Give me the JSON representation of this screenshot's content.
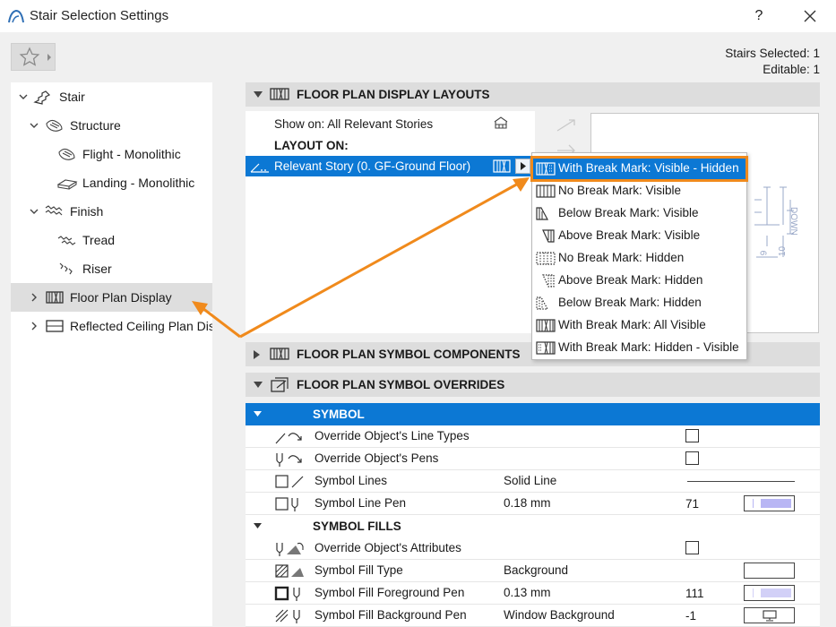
{
  "window": {
    "title": "Stair Selection Settings",
    "help_label": "?",
    "stairs_selected": "Stairs Selected: 1",
    "editable": "Editable: 1"
  },
  "tree": {
    "items": [
      {
        "label": "Stair"
      },
      {
        "label": "Structure"
      },
      {
        "label": "Flight - Monolithic"
      },
      {
        "label": "Landing - Monolithic"
      },
      {
        "label": "Finish"
      },
      {
        "label": "Tread"
      },
      {
        "label": "Riser"
      },
      {
        "label": "Floor Plan Display"
      },
      {
        "label": "Reflected Ceiling Plan Display"
      }
    ]
  },
  "sections": {
    "layouts": "FLOOR PLAN DISPLAY LAYOUTS",
    "components": "FLOOR PLAN SYMBOL COMPONENTS",
    "overrides": "FLOOR PLAN SYMBOL OVERRIDES"
  },
  "layout_panel": {
    "show_on": "Show on: All Relevant Stories",
    "layout_on": "LAYOUT ON:",
    "relevant_story": "Relevant Story (0. GF-Ground Floor)"
  },
  "preview": {
    "label_down": "DOWN",
    "label_9": "9",
    "label_10": "10"
  },
  "dropdown": {
    "items": [
      {
        "label": "With Break Mark: Visible - Hidden"
      },
      {
        "label": "No Break Mark: Visible"
      },
      {
        "label": "Below Break Mark: Visible"
      },
      {
        "label": "Above Break Mark: Visible"
      },
      {
        "label": "No Break Mark: Hidden"
      },
      {
        "label": "Above Break Mark: Hidden"
      },
      {
        "label": "Below Break Mark: Hidden"
      },
      {
        "label": "With Break Mark: All Visible"
      },
      {
        "label": "With Break Mark: Hidden - Visible"
      }
    ]
  },
  "table": {
    "group_symbol": "SYMBOL",
    "group_fills": "SYMBOL FILLS",
    "rows": [
      {
        "name": "Override Object's Line Types"
      },
      {
        "name": "Override Object's Pens"
      },
      {
        "name": "Symbol Lines",
        "value": "Solid Line"
      },
      {
        "name": "Symbol Line Pen",
        "value": "0.18 mm",
        "number": "71"
      },
      {
        "name": "Override Object's Attributes"
      },
      {
        "name": "Symbol Fill Type",
        "value": "Background"
      },
      {
        "name": "Symbol Fill Foreground Pen",
        "value": "0.13 mm",
        "number": "111"
      },
      {
        "name": "Symbol Fill Background Pen",
        "value": "Window Background",
        "number": "-1"
      }
    ]
  },
  "colors": {
    "selection_blue": "#0c78d4",
    "highlight_orange": "#f08a1c",
    "pen_swatch": "#b8b6f4"
  }
}
